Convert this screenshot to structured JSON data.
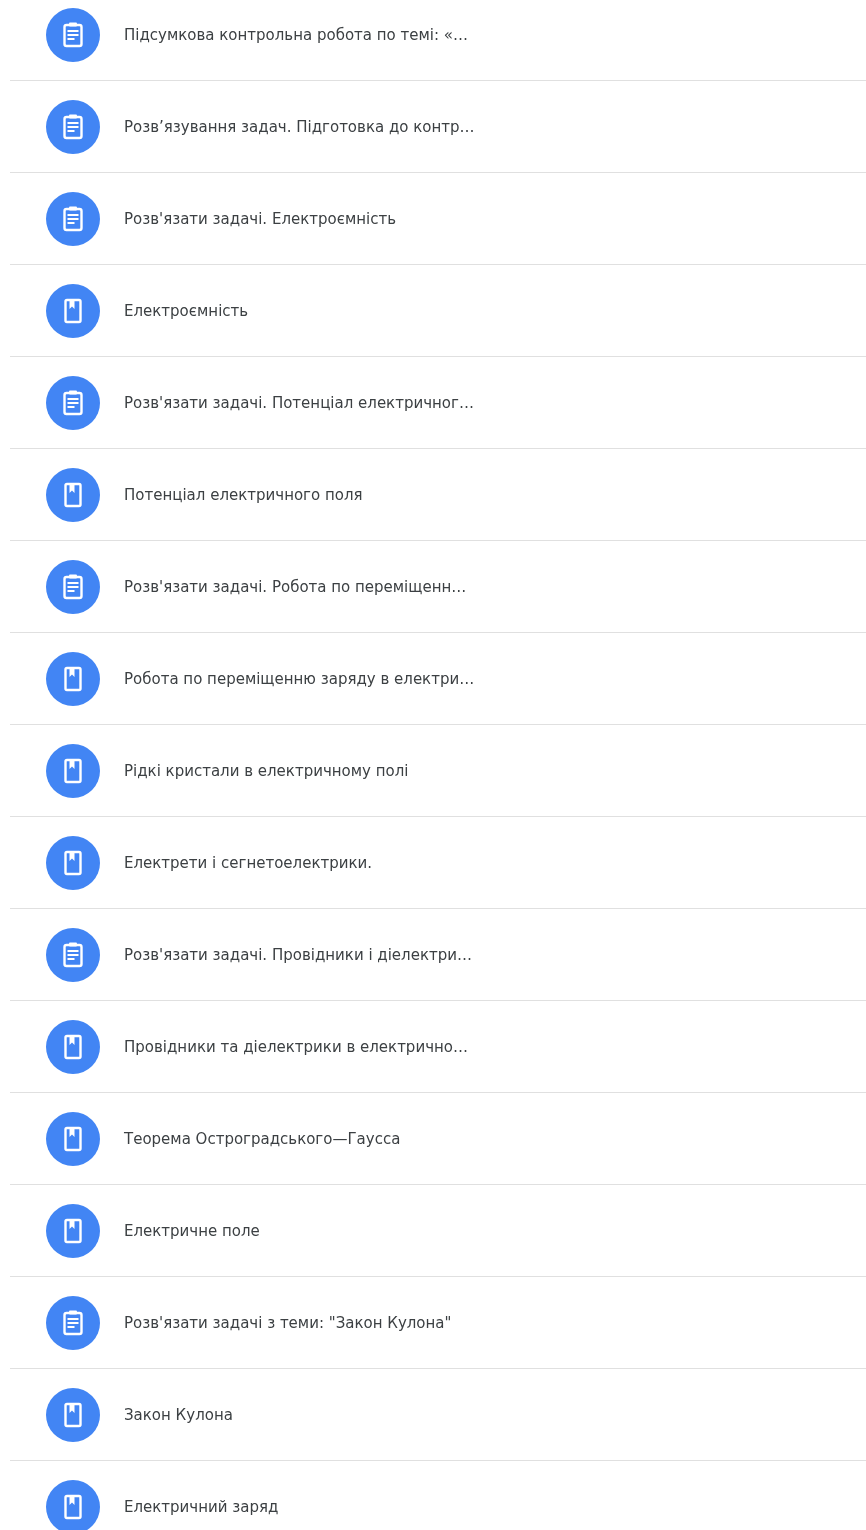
{
  "items": [
    {
      "kind": "assignment",
      "title": "Підсумкова контрольна робота по темі: «…"
    },
    {
      "kind": "assignment",
      "title": "Розв’язування задач. Підготовка до контр…"
    },
    {
      "kind": "assignment",
      "title": "Розв'язати задачі. Електроємність"
    },
    {
      "kind": "material",
      "title": "Електроємність"
    },
    {
      "kind": "assignment",
      "title": "Розв'язати задачі. Потенціал електричног…"
    },
    {
      "kind": "material",
      "title": "Потенціал електричного поля"
    },
    {
      "kind": "assignment",
      "title": "Розв'язати задачі. Робота по переміщенн…"
    },
    {
      "kind": "material",
      "title": "Робота по переміщенню заряду в електри…"
    },
    {
      "kind": "material",
      "title": "Рідкі кристали в електричному полі"
    },
    {
      "kind": "material",
      "title": "Електрети і сегнетоелектрики."
    },
    {
      "kind": "assignment",
      "title": "Розв'язати задачі. Провідники і діелектри…"
    },
    {
      "kind": "material",
      "title": "Провідники та діелектрики в електрично…"
    },
    {
      "kind": "material",
      "title": "Теорема Остроградського—Гаусса"
    },
    {
      "kind": "material",
      "title": "Електричне поле"
    },
    {
      "kind": "assignment",
      "title": "Розв'язати задачі з теми: \"Закон Кулона\""
    },
    {
      "kind": "material",
      "title": "Закон Кулона"
    },
    {
      "kind": "material",
      "title": "Електричний заряд"
    }
  ]
}
